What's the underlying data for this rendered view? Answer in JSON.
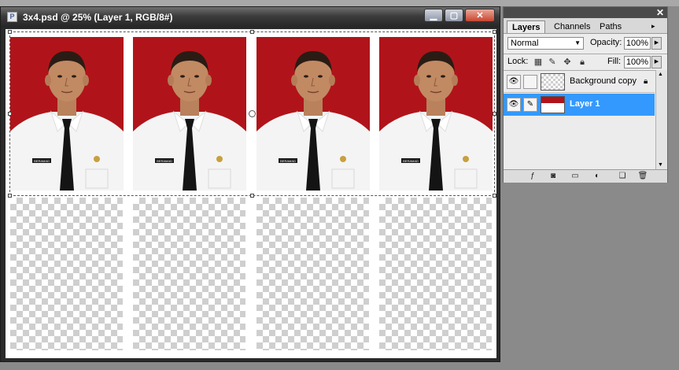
{
  "document": {
    "title": "3x4.psd @ 25% (Layer 1, RGB/8#)",
    "photo_count": 4,
    "name_tag": "BERAMAD",
    "colors": {
      "photo_background": "#b0141a",
      "checker": "#cfcfcf"
    }
  },
  "window_controls": {
    "minimize_icon": "minimize-icon",
    "maximize_icon": "maximize-icon",
    "close_icon": "close-icon"
  },
  "layers_panel": {
    "tabs": [
      {
        "label": "Layers",
        "active": true
      },
      {
        "label": "Channels",
        "active": false
      },
      {
        "label": "Paths",
        "active": false
      }
    ],
    "blend_mode": "Normal",
    "opacity_label": "Opacity:",
    "opacity_value": "100%",
    "lock_label": "Lock:",
    "fill_label": "Fill:",
    "fill_value": "100%",
    "layers": [
      {
        "name": "Background copy",
        "visible": true,
        "locked": true,
        "selected": false
      },
      {
        "name": "Layer 1",
        "visible": true,
        "locked": false,
        "selected": true
      }
    ],
    "bottom_icons": [
      "link-layers-icon",
      "layer-style-icon",
      "layer-mask-icon",
      "new-group-icon",
      "adjustment-layer-icon",
      "new-layer-icon",
      "delete-layer-icon"
    ],
    "colors": {
      "selected_row": "#3399ff"
    }
  }
}
